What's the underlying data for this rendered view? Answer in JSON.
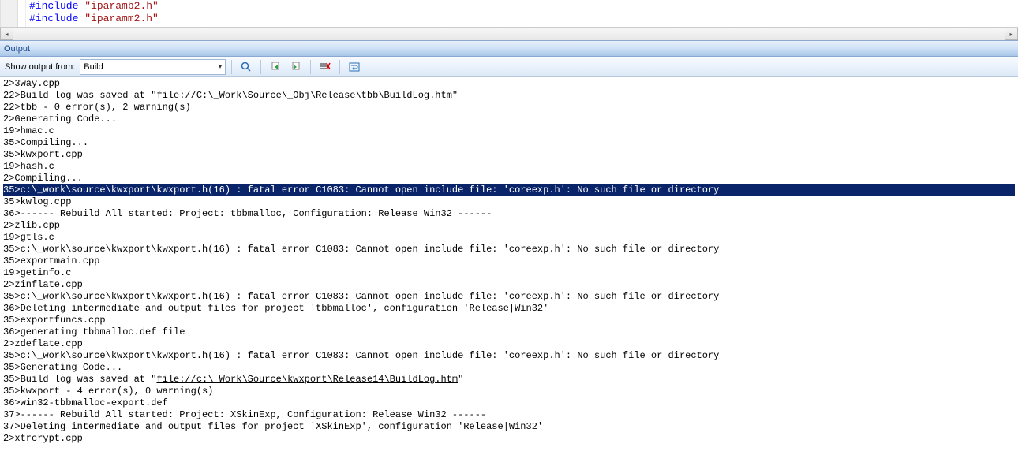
{
  "code": {
    "line1_keyword": "#include",
    "line1_string": "\"iparamb2.h\"",
    "line2_keyword": "#include",
    "line2_string": "\"iparamm2.h\""
  },
  "output": {
    "title": "Output",
    "toolbar_label": "Show output from:",
    "source_selected": "Build",
    "icons": {
      "find": "find-icon",
      "prev": "previous-message-icon",
      "next": "next-message-icon",
      "clear": "clear-all-icon",
      "wrap": "toggle-word-wrap-icon"
    },
    "lines": [
      {
        "prefix": "2>",
        "text": "3way.cpp"
      },
      {
        "prefix": "22>",
        "text": "Build log was saved at \"",
        "link": "file://C:\\_Work\\Source\\_Obj\\Release\\tbb\\BuildLog.htm",
        "after": "\""
      },
      {
        "prefix": "22>",
        "text": "tbb - 0 error(s), 2 warning(s)"
      },
      {
        "prefix": "2>",
        "text": "Generating Code..."
      },
      {
        "prefix": "19>",
        "text": "hmac.c"
      },
      {
        "prefix": "35>",
        "text": "Compiling..."
      },
      {
        "prefix": "35>",
        "text": "kwxport.cpp"
      },
      {
        "prefix": "19>",
        "text": "hash.c"
      },
      {
        "prefix": "2>",
        "text": "Compiling..."
      },
      {
        "prefix": "35>",
        "text": "c:\\_work\\source\\kwxport\\kwxport.h(16) : fatal error C1083: Cannot open include file: 'coreexp.h': No such file or directory",
        "selected": true
      },
      {
        "prefix": "35>",
        "text": "kwlog.cpp"
      },
      {
        "prefix": "36>",
        "text": "------ Rebuild All started: Project: tbbmalloc, Configuration: Release Win32 ------"
      },
      {
        "prefix": "2>",
        "text": "zlib.cpp"
      },
      {
        "prefix": "19>",
        "text": "gtls.c"
      },
      {
        "prefix": "35>",
        "text": "c:\\_work\\source\\kwxport\\kwxport.h(16) : fatal error C1083: Cannot open include file: 'coreexp.h': No such file or directory"
      },
      {
        "prefix": "35>",
        "text": "exportmain.cpp"
      },
      {
        "prefix": "19>",
        "text": "getinfo.c"
      },
      {
        "prefix": "2>",
        "text": "zinflate.cpp"
      },
      {
        "prefix": "35>",
        "text": "c:\\_work\\source\\kwxport\\kwxport.h(16) : fatal error C1083: Cannot open include file: 'coreexp.h': No such file or directory"
      },
      {
        "prefix": "36>",
        "text": "Deleting intermediate and output files for project 'tbbmalloc', configuration 'Release|Win32'"
      },
      {
        "prefix": "35>",
        "text": "exportfuncs.cpp"
      },
      {
        "prefix": "36>",
        "text": "generating tbbmalloc.def file"
      },
      {
        "prefix": "2>",
        "text": "zdeflate.cpp"
      },
      {
        "prefix": "35>",
        "text": "c:\\_work\\source\\kwxport\\kwxport.h(16) : fatal error C1083: Cannot open include file: 'coreexp.h': No such file or directory"
      },
      {
        "prefix": "35>",
        "text": "Generating Code..."
      },
      {
        "prefix": "35>",
        "text": "Build log was saved at \"",
        "link": "file://c:\\_Work\\Source\\kwxport\\Release14\\BuildLog.htm",
        "after": "\""
      },
      {
        "prefix": "35>",
        "text": "kwxport - 4 error(s), 0 warning(s)"
      },
      {
        "prefix": "36>",
        "text": "win32-tbbmalloc-export.def"
      },
      {
        "prefix": "37>",
        "text": "------ Rebuild All started: Project: XSkinExp, Configuration: Release Win32 ------"
      },
      {
        "prefix": "37>",
        "text": "Deleting intermediate and output files for project 'XSkinExp', configuration 'Release|Win32'"
      },
      {
        "prefix": "2>",
        "text": "xtrcrypt.cpp"
      }
    ]
  }
}
